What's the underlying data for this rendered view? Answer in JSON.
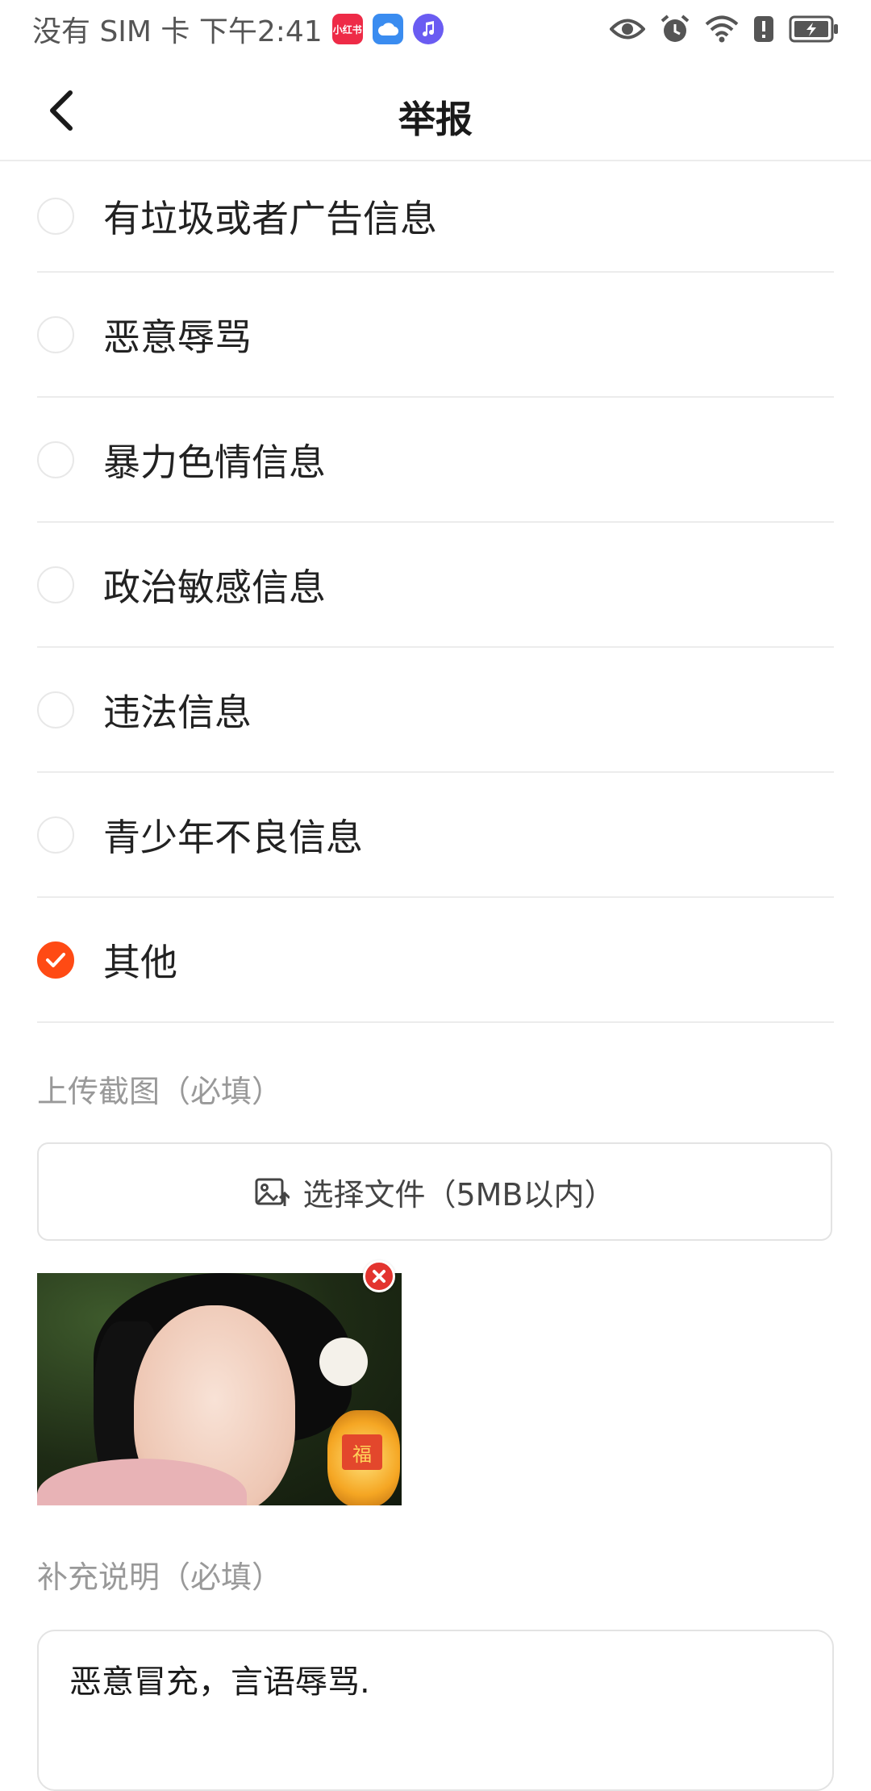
{
  "status_bar": {
    "left_text": "没有 SIM 卡 下午2:41",
    "app_icons": [
      {
        "name": "xiaohongshu-icon",
        "text": "小红书",
        "color": "#ee2b47"
      },
      {
        "name": "cloud-icon",
        "color": "#3a8cf0"
      },
      {
        "name": "music-icon",
        "color": "#6a5cf2"
      }
    ],
    "right_icons": [
      "eye-icon",
      "alarm-icon",
      "wifi-icon",
      "alert-icon",
      "battery-icon"
    ]
  },
  "nav": {
    "back_icon": "chevron-left-icon",
    "title": "举报"
  },
  "reasons": [
    {
      "label": "有垃圾或者广告信息",
      "selected": false
    },
    {
      "label": "恶意辱骂",
      "selected": false
    },
    {
      "label": "暴力色情信息",
      "selected": false
    },
    {
      "label": "政治敏感信息",
      "selected": false
    },
    {
      "label": "违法信息",
      "selected": false
    },
    {
      "label": "青少年不良信息",
      "selected": false
    },
    {
      "label": "其他",
      "selected": true
    }
  ],
  "upload": {
    "section_label": "上传截图（必填）",
    "button_label": "选择文件（5MB以内）",
    "button_icon": "image-upload-icon",
    "thumbnail_tag": "福"
  },
  "notes": {
    "section_label": "补充说明（必填）",
    "value": "恶意冒充，言语辱骂."
  },
  "colors": {
    "accent": "#ff4a14",
    "divider": "#ececec",
    "hint_text": "#999999",
    "remove_badge": "#e3342f"
  }
}
